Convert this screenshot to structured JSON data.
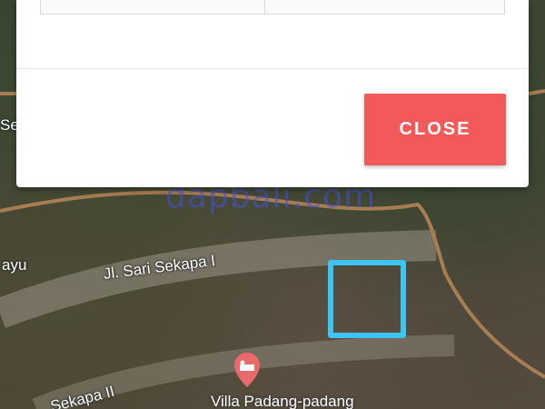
{
  "map": {
    "roads": [
      {
        "id": "jl-sari-sekapa-1",
        "label": "Jl. Sari Sekapa I"
      },
      {
        "id": "sekapa-2",
        "label": "Sekapa II"
      },
      {
        "id": "ayu-fragment",
        "label": "ayu"
      },
      {
        "id": "se-fragment",
        "label": "Se"
      }
    ],
    "watermark": "dapbali.com",
    "place": {
      "label": "Villa Padang-padang",
      "pin_icon": "hotel-bed-pin-icon",
      "pin_color": "#e86a6a"
    },
    "selection_color": "#3cc4f5",
    "boundary_color": "#a77d52"
  },
  "modal": {
    "table": {
      "rows": [
        [
          "",
          ""
        ]
      ]
    },
    "close_label": "CLOSE",
    "close_color": "#f25a5a"
  }
}
